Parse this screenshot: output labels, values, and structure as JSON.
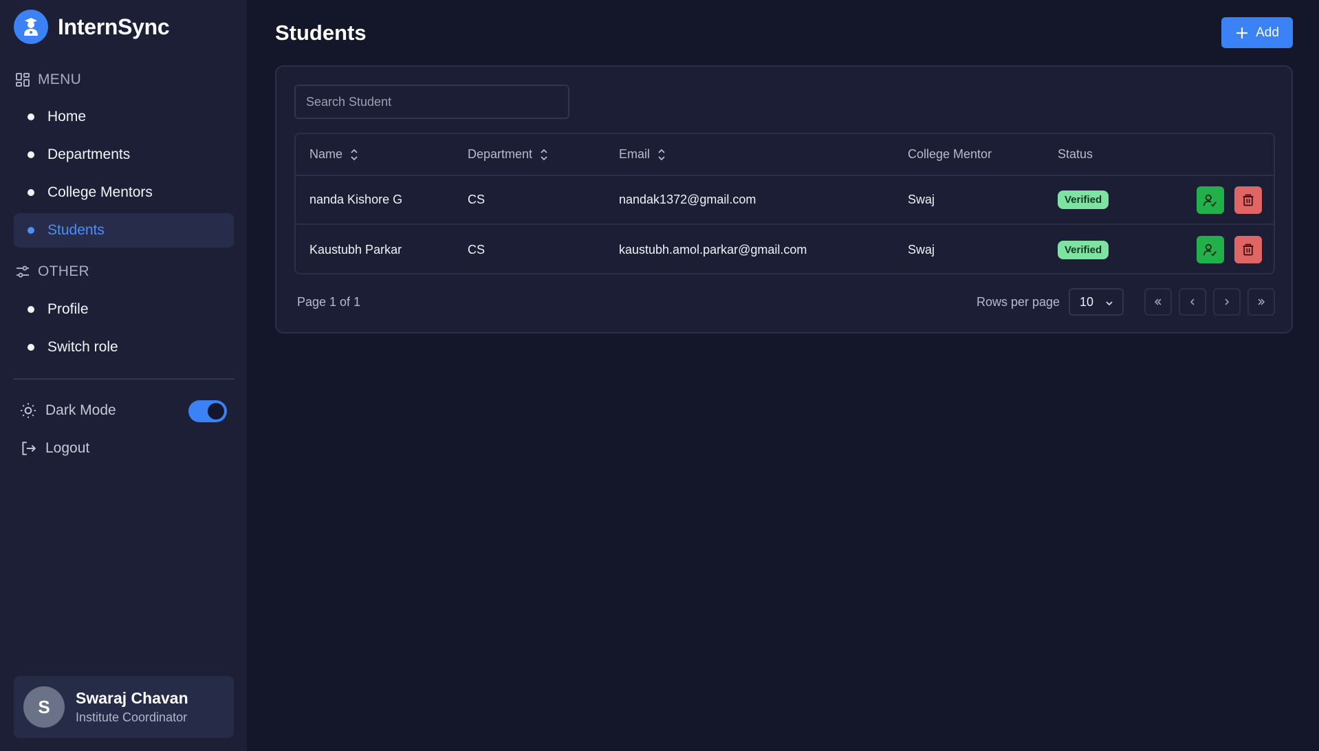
{
  "brand": {
    "name": "InternSync",
    "logo_icon": "student-icon"
  },
  "sidebar": {
    "menu_heading": "MENU",
    "menu_items": [
      {
        "label": "Home",
        "active": false
      },
      {
        "label": "Departments",
        "active": false
      },
      {
        "label": "College Mentors",
        "active": false
      },
      {
        "label": "Students",
        "active": true
      }
    ],
    "other_heading": "OTHER",
    "other_items": [
      {
        "label": "Profile"
      },
      {
        "label": "Switch role"
      }
    ],
    "dark_mode_label": "Dark Mode",
    "dark_mode_on": true,
    "logout_label": "Logout"
  },
  "user": {
    "initial": "S",
    "name": "Swaraj Chavan",
    "role": "Institute Coordinator"
  },
  "page": {
    "title": "Students",
    "add_label": "Add"
  },
  "search": {
    "placeholder": "Search Student"
  },
  "table": {
    "columns": [
      "Name",
      "Department",
      "Email",
      "College Mentor",
      "Status"
    ],
    "rows": [
      {
        "name": "nanda Kishore G",
        "department": "CS",
        "email": "nandak1372@gmail.com",
        "mentor": "Swaj",
        "status": "Verified"
      },
      {
        "name": "Kaustubh Parkar",
        "department": "CS",
        "email": "kaustubh.amol.parkar@gmail.com",
        "mentor": "Swaj",
        "status": "Verified"
      }
    ]
  },
  "pagination": {
    "page_text": "Page 1 of 1",
    "rows_per_page_label": "Rows per page",
    "rows_per_page": "10"
  },
  "colors": {
    "accent": "#3b82f6",
    "verified_badge": "#7ee3a2",
    "verify_button": "#22b04b",
    "delete_button": "#e06666",
    "background": "#141629",
    "sidebar": "#1c1f36"
  }
}
